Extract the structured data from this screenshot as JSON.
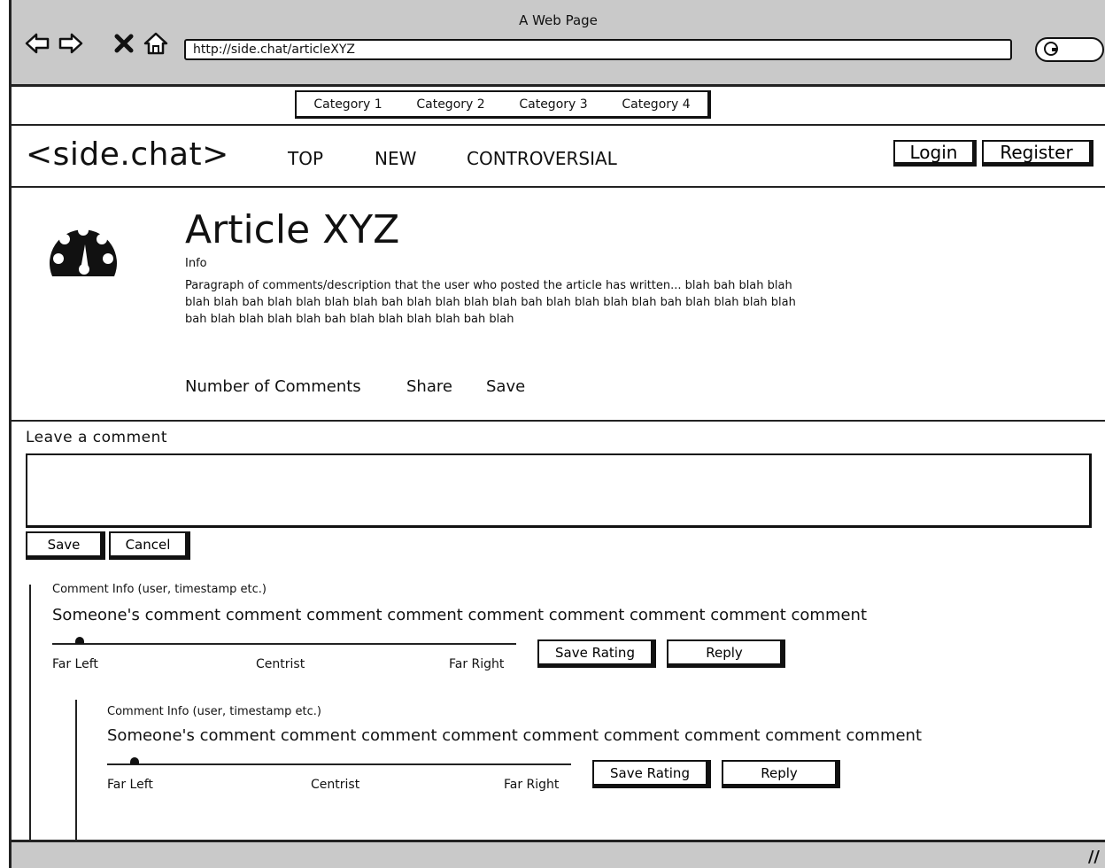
{
  "browser": {
    "window_title": "A Web Page",
    "url": "http://side.chat/articleXYZ"
  },
  "categories": [
    "Category 1",
    "Category 2",
    "Category 3",
    "Category 4"
  ],
  "header": {
    "logo": "<side.chat>",
    "nav": [
      "TOP",
      "NEW",
      "CONTROVERSIAL"
    ],
    "login_label": "Login",
    "register_label": "Register"
  },
  "article": {
    "icon": "dashboard-gauge-icon",
    "title": "Article XYZ",
    "info": "Info",
    "description": "Paragraph of comments/description that the user who posted the article has written... blah bah blah blah blah blah bah blah blah blah blah bah blah blah blah blah bah blah blah blah blah bah blah blah blah blah bah blah blah blah blah bah blah blah blah blah bah blah",
    "comments_label": "Number of Comments",
    "share_label": "Share",
    "save_label": "Save"
  },
  "comment_form": {
    "label": "Leave a comment",
    "value": "",
    "save_label": "Save",
    "cancel_label": "Cancel"
  },
  "comments": [
    {
      "info": "Comment Info (user, timestamp etc.)",
      "text": "Someone's comment comment comment comment comment comment comment comment comment",
      "slider": {
        "left_label": "Far Left",
        "center_label": "Centrist",
        "right_label": "Far Right",
        "value": 0.06
      },
      "save_rating_label": "Save Rating",
      "reply_label": "Reply"
    },
    {
      "info": "Comment Info (user, timestamp etc.)",
      "text": "Someone's comment comment comment comment comment comment comment comment comment",
      "slider": {
        "left_label": "Far Left",
        "center_label": "Centrist",
        "right_label": "Far Right",
        "value": 0.06
      },
      "save_rating_label": "Save Rating",
      "reply_label": "Reply"
    }
  ]
}
